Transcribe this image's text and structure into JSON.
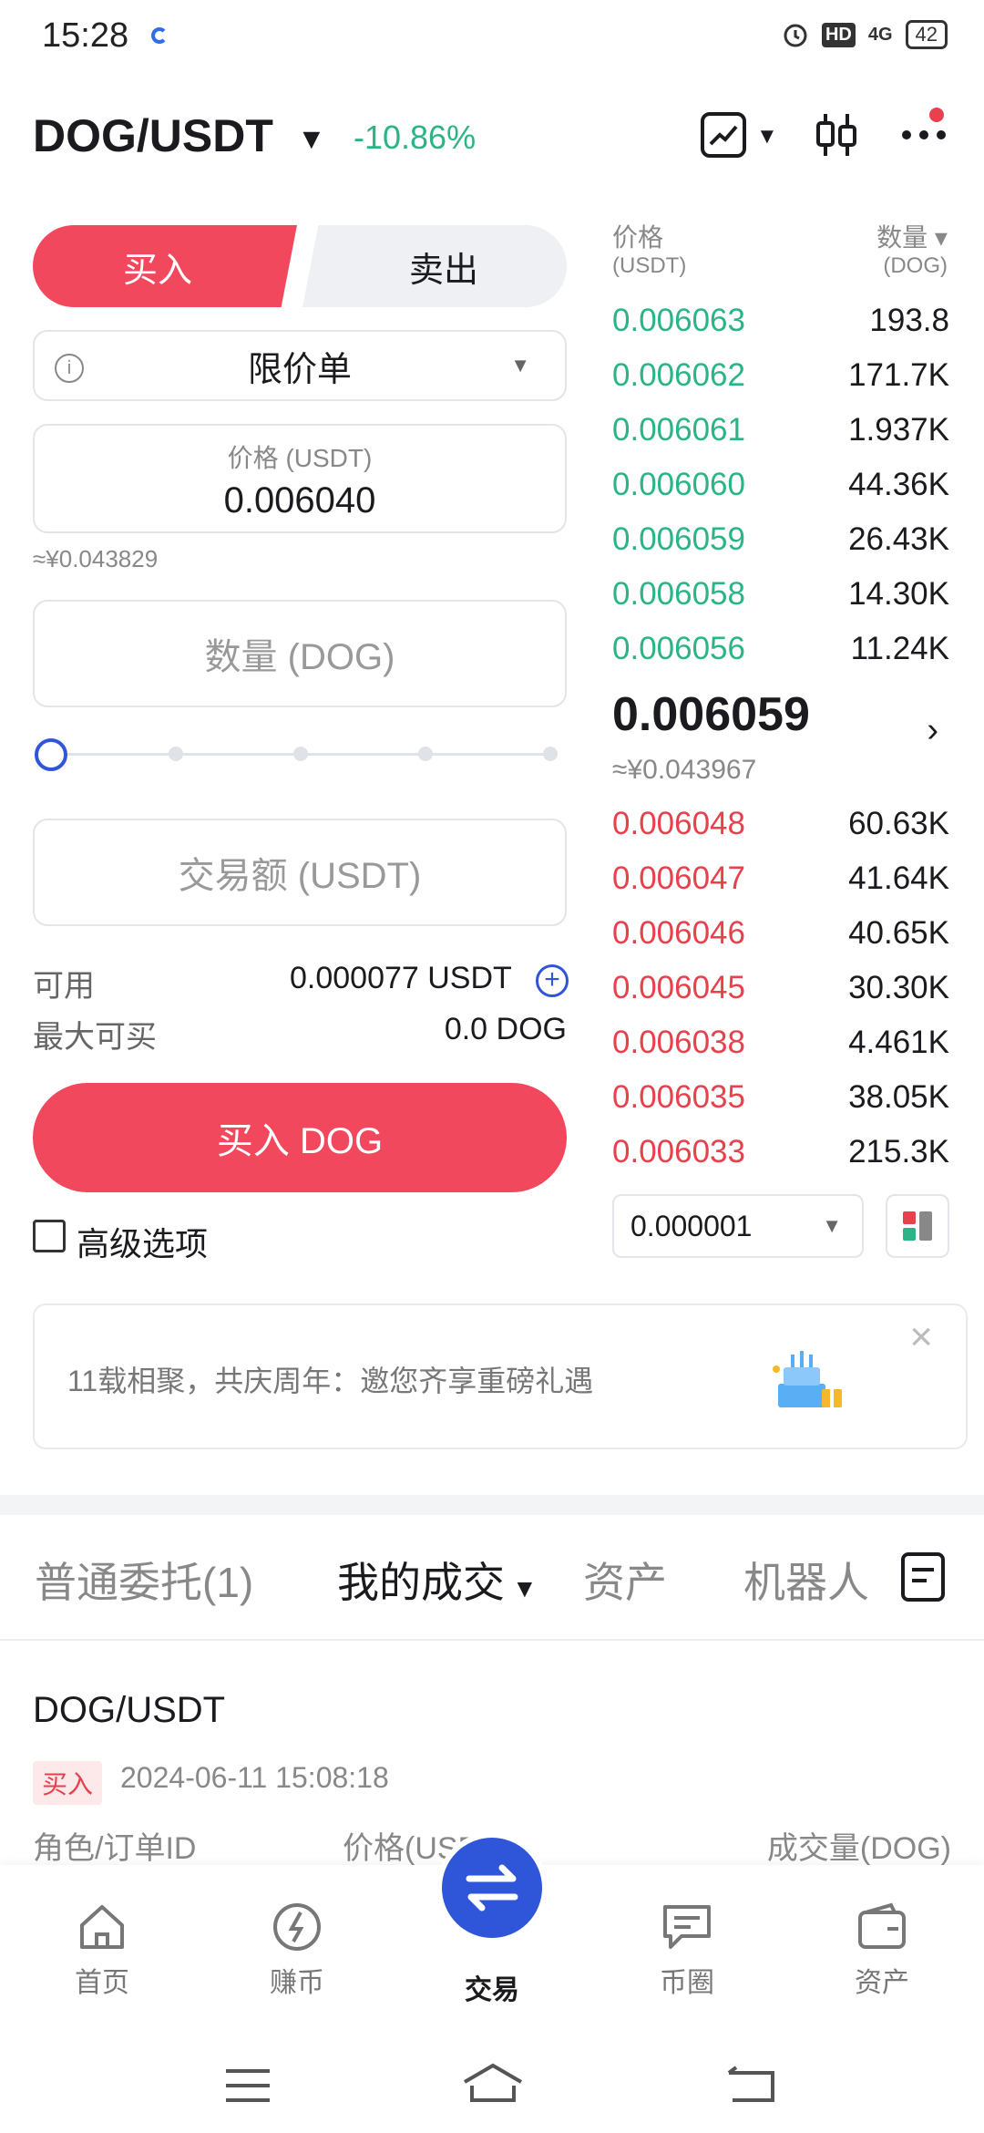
{
  "status": {
    "time": "15:28",
    "hd": "HD",
    "network": "4G",
    "battery": "42"
  },
  "header": {
    "pair": "DOG/USDT",
    "change": "-10.86%"
  },
  "trade": {
    "buy_tab": "买入",
    "sell_tab": "卖出",
    "order_type": "限价单",
    "price_label": "价格 (USDT)",
    "price_value": "0.006040",
    "price_approx": "≈¥0.043829",
    "qty_placeholder": "数量 (DOG)",
    "slider_value_percent": 0,
    "amount_placeholder": "交易额 (USDT)",
    "available_label": "可用",
    "available_value": "0.000077 USDT",
    "max_buy_label": "最大可买",
    "max_buy_value": "0.0 DOG",
    "buy_button": "买入 DOG",
    "advanced_label": "高级选项"
  },
  "orderbook": {
    "price_header": "价格",
    "price_unit": "(USDT)",
    "qty_header": "数量 ▾",
    "qty_unit": "(DOG)",
    "asks": [
      {
        "price": "0.006063",
        "qty": "193.8"
      },
      {
        "price": "0.006062",
        "qty": "171.7K"
      },
      {
        "price": "0.006061",
        "qty": "1.937K"
      },
      {
        "price": "0.006060",
        "qty": "44.36K"
      },
      {
        "price": "0.006059",
        "qty": "26.43K"
      },
      {
        "price": "0.006058",
        "qty": "14.30K"
      },
      {
        "price": "0.006056",
        "qty": "11.24K"
      }
    ],
    "last_price": "0.006059",
    "last_approx": "≈¥0.043967",
    "bids": [
      {
        "price": "0.006048",
        "qty": "60.63K"
      },
      {
        "price": "0.006047",
        "qty": "41.64K"
      },
      {
        "price": "0.006046",
        "qty": "40.65K"
      },
      {
        "price": "0.006045",
        "qty": "30.30K"
      },
      {
        "price": "0.006038",
        "qty": "4.461K"
      },
      {
        "price": "0.006035",
        "qty": "38.05K"
      },
      {
        "price": "0.006033",
        "qty": "215.3K"
      }
    ],
    "depth_step": "0.000001"
  },
  "banner": {
    "text": "11载相聚，共庆周年：邀您齐享重磅礼遇"
  },
  "tabs": {
    "open_orders": "普通委托(1)",
    "my_trades": "我的成交",
    "assets": "资产",
    "bots": "机器人"
  },
  "trade_record": {
    "pair": "DOG/USDT",
    "side": "买入",
    "time": "2024-06-11 15:08:18",
    "col_role": "角色/订单ID",
    "col_price": "价格(USDT)",
    "col_qty": "成交量(DOG)"
  },
  "nav": {
    "home": "首页",
    "earn": "赚币",
    "trade": "交易",
    "community": "币圈",
    "assets": "资产"
  },
  "colors": {
    "buy": "#f2485d",
    "ask": "#2bb487",
    "bid": "#e8414e",
    "accent": "#2f55d8"
  }
}
